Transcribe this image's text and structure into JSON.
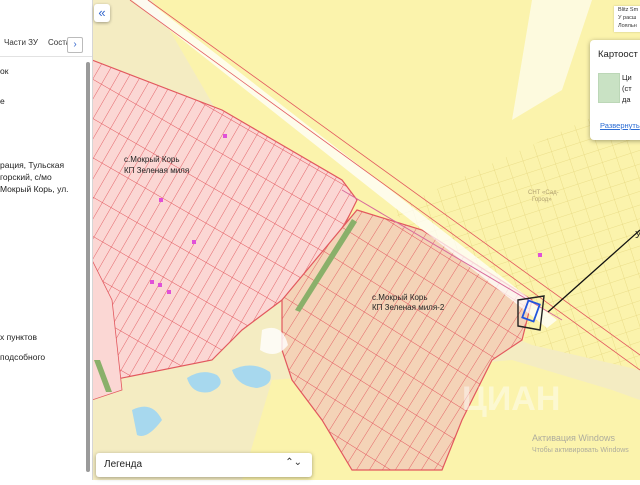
{
  "sidebar": {
    "tabs": [
      "Части ЗУ",
      "Соста"
    ],
    "tabs_arrow": "›",
    "lines": [
      "ок",
      "е",
      "рация, Тульская",
      "горский, с/мо",
      "Мокрый Корь, ул.",
      "х пунктов",
      "подсобного"
    ]
  },
  "controls": {
    "collapse": "«",
    "legend": "Легенда",
    "legend_chevron": "⌃⌄"
  },
  "panel": {
    "title": "Картоост",
    "lines": [
      "Ци",
      "(ст",
      "да"
    ],
    "link": "Развернуть"
  },
  "top_right_lines": [
    "Blitz Sm",
    "У расш",
    "Лояльн"
  ],
  "map": {
    "labels": {
      "settlement_1_name": "с.Мокрый Корь",
      "settlement_1_sub": "КП Зеленая миля",
      "settlement_2_name": "с.Мокрый Корь",
      "settlement_2_sub": "КП Зеленая миля-2",
      "snt_1": "СНТ «Сад-",
      "snt_2": "Город»",
      "callout_letter": "У"
    },
    "watermarks": [
      "ЦИАН",
      "Активация Windows",
      "Чтобы активировать Windows"
    ]
  },
  "colors": {
    "background": "#f4ecc2",
    "yellow_zone": "#fbf3ac",
    "pink_zone": "#fbd7d4",
    "pink_line": "#e2585e",
    "peach_zone": "#f4d3b7",
    "green_strip": "#8ab06a",
    "water": "#a7d8ee",
    "road": "#ffffff",
    "highlight": "#2255dd",
    "marker": "#e050d8"
  }
}
